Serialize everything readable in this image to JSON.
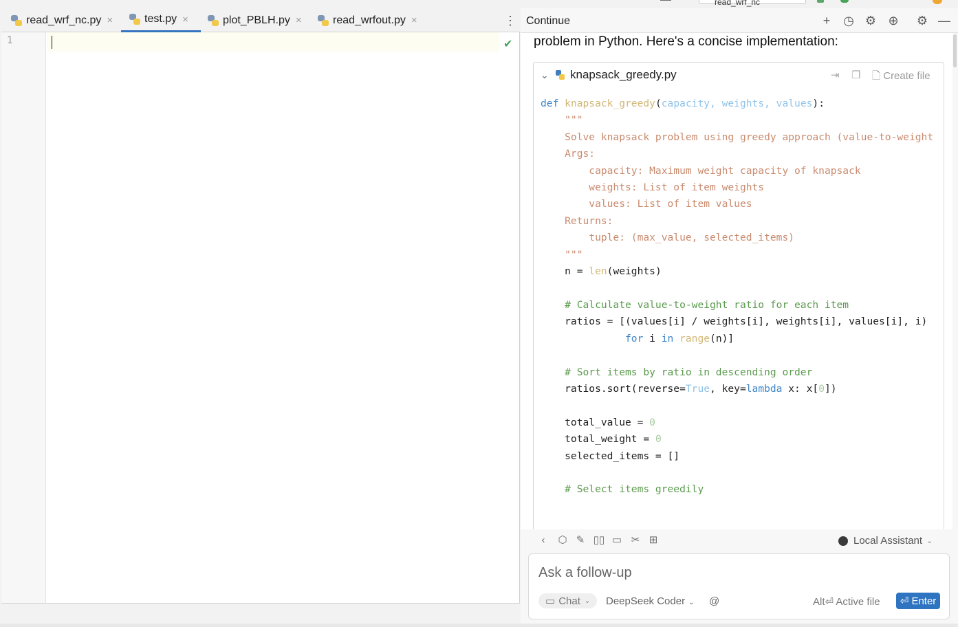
{
  "editor": {
    "tabs": [
      {
        "label": "read_wrf_nc.py",
        "close": "×"
      },
      {
        "label": "test.py",
        "close": "×"
      },
      {
        "label": "plot_PBLH.py",
        "close": "×"
      },
      {
        "label": "read_wrfout.py",
        "close": "×"
      }
    ],
    "active_tab": "test.py",
    "line_number": "1",
    "menu_glyph": "⋮",
    "check_glyph": "✔"
  },
  "window": {
    "run_config": "read_wrf_nc"
  },
  "continue_panel": {
    "title": "Continue",
    "header_icons": [
      "plus-icon",
      "history-icon",
      "gear-icon",
      "globe-icon",
      "settings-icon",
      "minimize-icon"
    ],
    "lead_text": "problem in Python. Here's a concise implementation:",
    "code_block": {
      "filename": "knapsack_greedy.py",
      "create_file_label": "Create file",
      "lines": [
        "def knapsack_greedy(capacity, weights, values):",
        "    \"\"\"",
        "    Solve knapsack problem using greedy approach (value-to-weight",
        "",
        "    Args:",
        "        capacity: Maximum weight capacity of knapsack",
        "        weights: List of item weights",
        "        values: List of item values",
        "",
        "    Returns:",
        "        tuple: (max_value, selected_items)",
        "    \"\"\"",
        "    n = len(weights)",
        "",
        "    # Calculate value-to-weight ratio for each item",
        "    ratios = [(values[i] / weights[i], weights[i], values[i], i)",
        "              for i in range(n)]",
        "",
        "    # Sort items by ratio in descending order",
        "    ratios.sort(reverse=True, key=lambda x: x[0])",
        "",
        "    total_value = 0",
        "    total_weight = 0",
        "    selected_items = []",
        "",
        "    # Select items greedily"
      ]
    },
    "toolbar": {
      "icons": [
        "back-icon",
        "cube-icon",
        "pencil-icon",
        "book-icon",
        "comment-icon",
        "tools-icon",
        "grid-icon"
      ],
      "assistant_label": "Local Assistant"
    },
    "input": {
      "placeholder": "Ask a follow-up",
      "mode_label": "Chat",
      "model_label": "DeepSeek Coder",
      "at_symbol": "@",
      "active_file_label": "Alt⏎ Active file",
      "enter_label": "⏎ Enter"
    }
  }
}
